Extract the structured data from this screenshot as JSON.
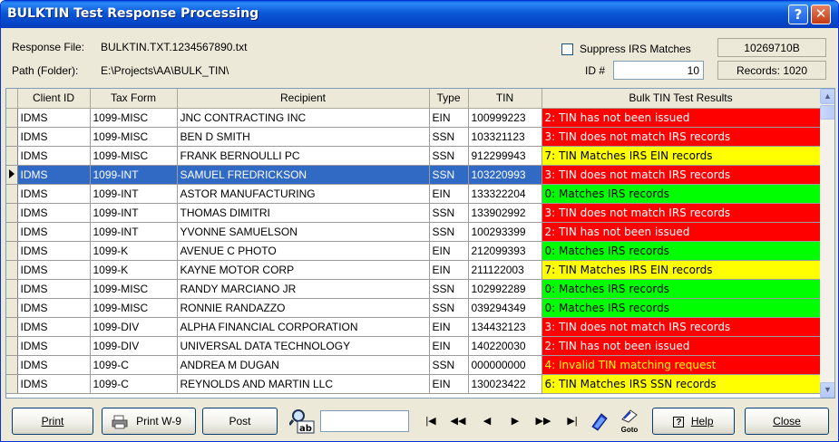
{
  "window": {
    "title": "BULKTIN Test Response Processing",
    "help_glyph": "?",
    "close_glyph": "✕"
  },
  "header": {
    "response_file_label": "Response File:",
    "response_file_value": "BULKTIN.TXT.1234567890.txt",
    "path_label": "Path (Folder):",
    "path_value": "E:\\Projects\\AA\\BULK_TIN\\",
    "suppress_label": "Suppress IRS Matches",
    "code_box": "10269710B",
    "id_label": "ID #",
    "id_value": "10",
    "records_box": "Records: 1020"
  },
  "grid": {
    "columns": [
      "Client ID",
      "Tax Form",
      "Recipient",
      "Type",
      "TIN",
      "Bulk TIN Test Results"
    ],
    "selected_row": 3,
    "rows": [
      {
        "client": "IDMS",
        "form": "1099-MISC",
        "recipient": "JNC CONTRACTING INC",
        "type": "EIN",
        "tin": "100999223",
        "result": "2: TIN has not been issued",
        "color": "red"
      },
      {
        "client": "IDMS",
        "form": "1099-MISC",
        "recipient": "BEN D SMITH",
        "type": "SSN",
        "tin": "103321123",
        "result": "3: TIN does not match IRS records",
        "color": "red"
      },
      {
        "client": "IDMS",
        "form": "1099-MISC",
        "recipient": "FRANK BERNOULLI PC",
        "type": "SSN",
        "tin": "912299943",
        "result": "7: TIN Matches IRS EIN records",
        "color": "yellow"
      },
      {
        "client": "IDMS",
        "form": "1099-INT",
        "recipient": "SAMUEL FREDRICKSON",
        "type": "SSN",
        "tin": "103220993",
        "result": "3: TIN does not match IRS records",
        "color": "red"
      },
      {
        "client": "IDMS",
        "form": "1099-INT",
        "recipient": "ASTOR MANUFACTURING",
        "type": "EIN",
        "tin": "133322204",
        "result": "0: Matches IRS records",
        "color": "green"
      },
      {
        "client": "IDMS",
        "form": "1099-INT",
        "recipient": "THOMAS DIMITRI",
        "type": "SSN",
        "tin": "133902992",
        "result": "3: TIN does not match IRS records",
        "color": "red"
      },
      {
        "client": "IDMS",
        "form": "1099-INT",
        "recipient": "YVONNE SAMUELSON",
        "type": "SSN",
        "tin": "100293399",
        "result": "2: TIN has not been issued",
        "color": "red"
      },
      {
        "client": "IDMS",
        "form": "1099-K",
        "recipient": "AVENUE C PHOTO",
        "type": "EIN",
        "tin": "212099393",
        "result": "0: Matches IRS records",
        "color": "green"
      },
      {
        "client": "IDMS",
        "form": "1099-K",
        "recipient": "KAYNE MOTOR CORP",
        "type": "EIN",
        "tin": "211122003",
        "result": "7: TIN Matches IRS EIN records",
        "color": "yellow"
      },
      {
        "client": "IDMS",
        "form": "1099-MISC",
        "recipient": "RANDY MARCIANO JR",
        "type": "SSN",
        "tin": "102992289",
        "result": "0: Matches IRS records",
        "color": "green"
      },
      {
        "client": "IDMS",
        "form": "1099-MISC",
        "recipient": "RONNIE RANDAZZO",
        "type": "SSN",
        "tin": "039294349",
        "result": "0: Matches IRS records",
        "color": "green"
      },
      {
        "client": "IDMS",
        "form": "1099-DIV",
        "recipient": "ALPHA FINANCIAL CORPORATION",
        "type": "EIN",
        "tin": "134432123",
        "result": "3: TIN does not match IRS records",
        "color": "red"
      },
      {
        "client": "IDMS",
        "form": "1099-DIV",
        "recipient": "UNIVERSAL DATA TECHNOLOGY",
        "type": "EIN",
        "tin": "140220030",
        "result": "2: TIN has not been issued",
        "color": "red"
      },
      {
        "client": "IDMS",
        "form": "1099-C",
        "recipient": "ANDREA M DUGAN",
        "type": "SSN",
        "tin": "000000000",
        "result": "4: Invalid TIN matching request",
        "color": "red-yellow"
      },
      {
        "client": "IDMS",
        "form": "1099-C",
        "recipient": "REYNOLDS AND MARTIN LLC",
        "type": "EIN",
        "tin": "130023422",
        "result": "6: TIN Matches IRS SSN records",
        "color": "yellow"
      }
    ]
  },
  "result_colors": {
    "red": "#ff0000",
    "green": "#00ff00",
    "yellow": "#ffff00",
    "red_text_on_red": "#ffff00"
  },
  "toolbar": {
    "print": "Print",
    "print_w9": "Print W-9",
    "post": "Post",
    "help": "Help",
    "close": "Close",
    "find_icon": "find-text-icon",
    "nav": [
      "|◀",
      "◀◀",
      "◀",
      "▶",
      "▶▶",
      "▶|"
    ],
    "goto_label": "Goto"
  }
}
